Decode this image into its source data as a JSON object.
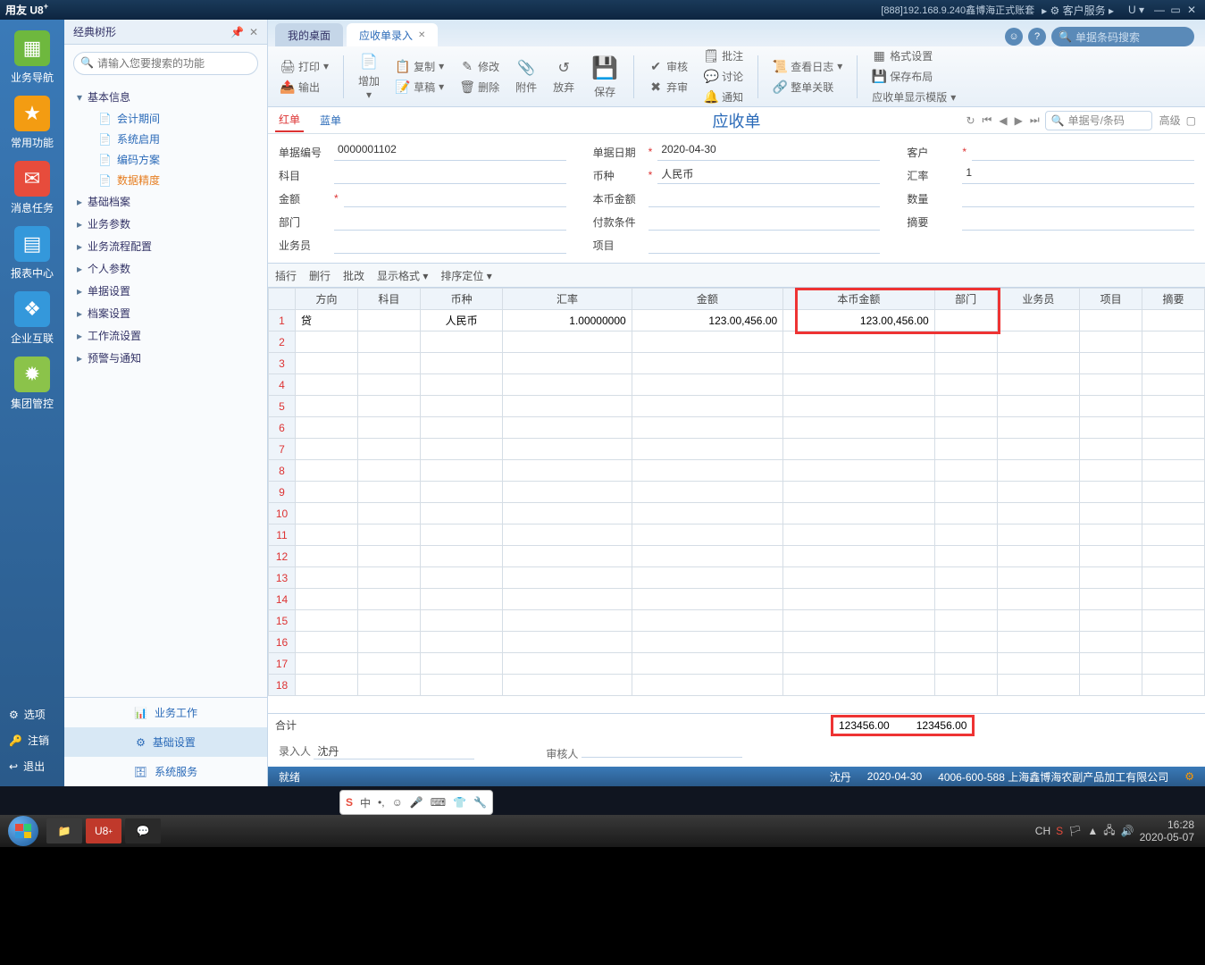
{
  "titlebar": {
    "logo": "用友 U8",
    "info": "[888]192.168.9.240鑫博海正式账套",
    "service": "客户服务",
    "u_menu": "U"
  },
  "rail": {
    "items": [
      "业务导航",
      "常用功能",
      "消息任务",
      "报表中心",
      "企业互联",
      "集团管控"
    ],
    "bottom": {
      "options": "选项",
      "logout": "注销",
      "exit": "退出"
    }
  },
  "tree": {
    "header": "经典树形",
    "search_placeholder": "请输入您要搜索的功能",
    "groups": [
      {
        "label": "基本信息",
        "expanded": true,
        "leaves": [
          "会计期间",
          "系统启用",
          "编码方案",
          "数据精度"
        ]
      },
      {
        "label": "基础档案"
      },
      {
        "label": "业务参数"
      },
      {
        "label": "业务流程配置"
      },
      {
        "label": "个人参数"
      },
      {
        "label": "单据设置"
      },
      {
        "label": "档案设置"
      },
      {
        "label": "工作流设置"
      },
      {
        "label": "预警与通知"
      }
    ],
    "selected_leaf": "数据精度",
    "bottom": {
      "biz": "业务工作",
      "base": "基础设置",
      "sys": "系统服务"
    }
  },
  "tabs": {
    "desktop": "我的桌面",
    "current": "应收单录入",
    "search_placeholder": "单据条码搜索"
  },
  "toolbar": {
    "print": "打印",
    "export": "输出",
    "add": "增加",
    "copy": "复制",
    "draft": "草稿",
    "modify": "修改",
    "delete": "删除",
    "attach": "附件",
    "abandon": "放弃",
    "save": "保存",
    "audit": "审核",
    "abandon_audit": "弃审",
    "note": "批注",
    "discuss": "讨论",
    "notify": "通知",
    "log": "查看日志",
    "related": "整单关联",
    "format": "格式设置",
    "layout": "保存布局",
    "tpl": "应收单显示模版"
  },
  "redblue": {
    "red": "红单",
    "blue": "蓝单",
    "title": "应收单",
    "search_placeholder": "单据号/条码",
    "adv": "高级"
  },
  "form": {
    "labels": {
      "no": "单据编号",
      "date": "单据日期",
      "customer": "客户",
      "subject": "科目",
      "currency": "币种",
      "rate": "汇率",
      "amount": "金额",
      "base_amount": "本币金额",
      "qty": "数量",
      "dept": "部门",
      "pay_terms": "付款条件",
      "summary": "摘要",
      "sales": "业务员",
      "project": "项目"
    },
    "values": {
      "no": "0000001102",
      "date": "2020-04-30",
      "currency": "人民币",
      "rate": "1"
    }
  },
  "gridbar": {
    "insert": "插行",
    "delete": "删行",
    "batch": "批改",
    "format": "显示格式",
    "sort": "排序定位"
  },
  "grid": {
    "cols": [
      "方向",
      "科目",
      "币种",
      "汇率",
      "金额",
      "本币金额",
      "部门",
      "业务员",
      "项目",
      "摘要"
    ],
    "row1": {
      "dir": "贷",
      "currency": "人民币",
      "rate": "1.00000000",
      "amount": "123.00,456.00",
      "base_amount": "123.00,456.00"
    }
  },
  "total": {
    "label": "合计",
    "amount": "123456.00",
    "base_amount": "123456.00"
  },
  "footer": {
    "entry_label": "录入人",
    "entry_val": "沈丹",
    "audit_label": "审核人"
  },
  "status": {
    "ready": "就绪",
    "user": "沈丹",
    "date": "2020-04-30",
    "phone": "4006-600-588 上海鑫博海农副产品加工有限公司"
  },
  "ime": {
    "zhong": "中"
  },
  "taskbar": {
    "lang": "CH",
    "time": "16:28",
    "date": "2020-05-07"
  }
}
